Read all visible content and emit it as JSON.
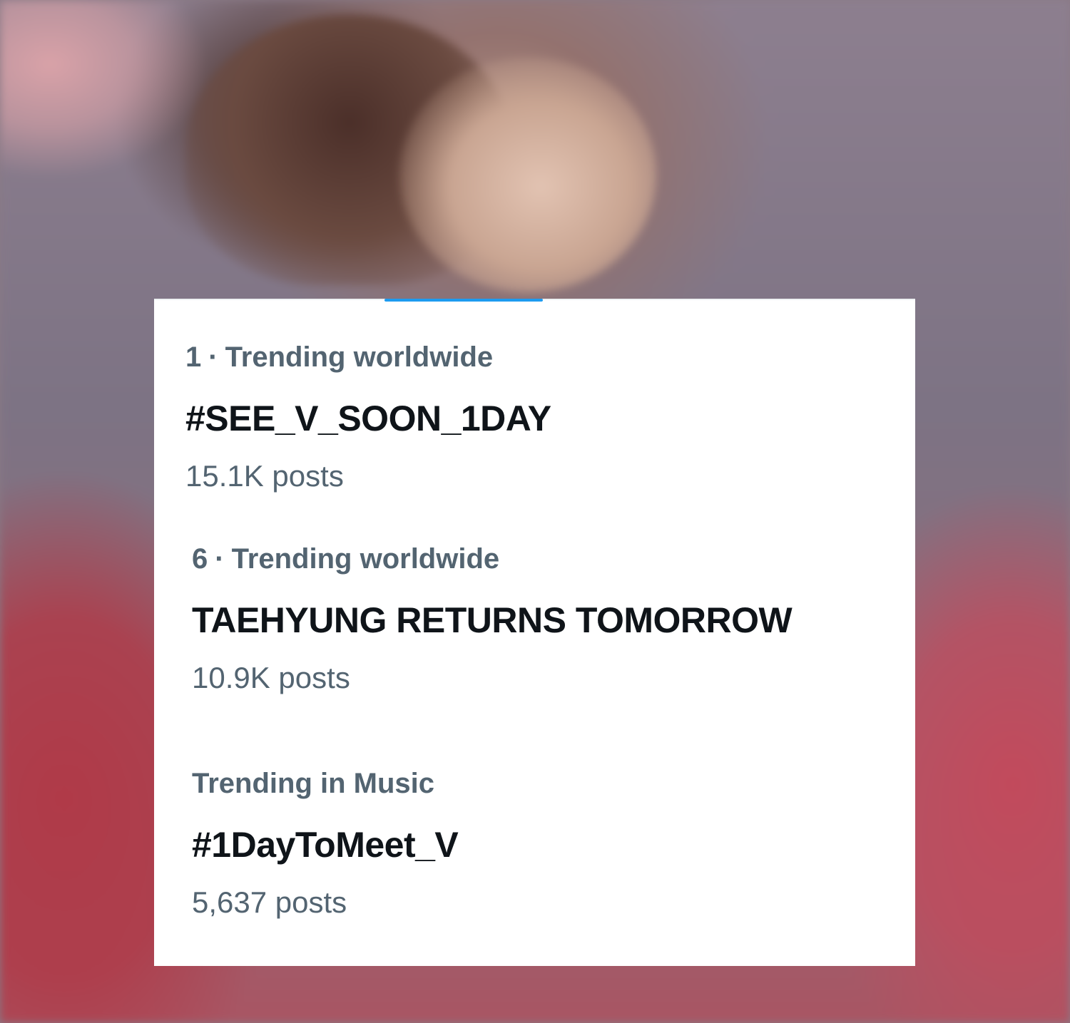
{
  "trends": [
    {
      "rank": "1",
      "separator": "·",
      "context": "Trending worldwide",
      "title": "#SEE_V_SOON_1DAY",
      "posts": "15.1K posts"
    },
    {
      "rank": "6",
      "separator": "·",
      "context": "Trending worldwide",
      "title": "TAEHYUNG RETURNS TOMORROW",
      "posts": "10.9K posts"
    },
    {
      "rank": "",
      "separator": "",
      "context": "Trending in Music",
      "title": "#1DayToMeet_V",
      "posts": "5,637 posts"
    }
  ],
  "colors": {
    "accent": "#1d9bf0",
    "primary_text": "#0f1419",
    "secondary_text": "#536471",
    "card_background": "#ffffff"
  }
}
